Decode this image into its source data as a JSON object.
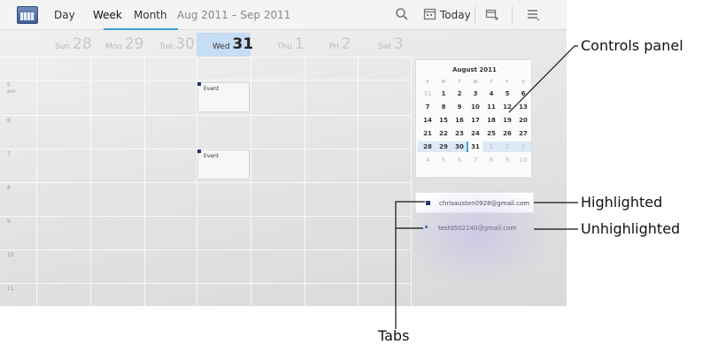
{
  "actionbar": {
    "tabs": [
      {
        "label": "Day"
      },
      {
        "label": "Week"
      },
      {
        "label": "Month"
      }
    ],
    "date_range": "Aug 2011 – Sep 2011",
    "today_label": "Today"
  },
  "days": [
    {
      "dow": "Sun",
      "num": "28"
    },
    {
      "dow": "Mon",
      "num": "29"
    },
    {
      "dow": "Tue",
      "num": "30"
    },
    {
      "dow": "Wed",
      "num": "31"
    },
    {
      "dow": "Thu",
      "num": "1"
    },
    {
      "dow": "Fri",
      "num": "2"
    },
    {
      "dow": "Sat",
      "num": "3"
    }
  ],
  "hours": [
    {
      "h": "5",
      "suffix": "am"
    },
    {
      "h": "6",
      "suffix": ""
    },
    {
      "h": "7",
      "suffix": ""
    },
    {
      "h": "8",
      "suffix": ""
    },
    {
      "h": "9",
      "suffix": ""
    },
    {
      "h": "10",
      "suffix": ""
    },
    {
      "h": "11",
      "suffix": ""
    }
  ],
  "events": [
    {
      "label": "Event"
    },
    {
      "label": "Event"
    }
  ],
  "mini_calendar": {
    "title": "August 2011",
    "weekdays": [
      "S",
      "M",
      "T",
      "W",
      "T",
      "F",
      "S"
    ],
    "rows": [
      [
        "31",
        "1",
        "2",
        "3",
        "4",
        "5",
        "6"
      ],
      [
        "7",
        "8",
        "9",
        "10",
        "11",
        "12",
        "13"
      ],
      [
        "14",
        "15",
        "16",
        "17",
        "18",
        "19",
        "20"
      ],
      [
        "21",
        "22",
        "23",
        "24",
        "25",
        "26",
        "27"
      ],
      [
        "28",
        "29",
        "30",
        "31",
        "1",
        "2",
        "3"
      ],
      [
        "4",
        "5",
        "6",
        "7",
        "8",
        "9",
        "10"
      ]
    ]
  },
  "accounts": [
    {
      "email": "chrisausten0928@gmail.com",
      "color": "#1f2f6f"
    },
    {
      "email": "test0502140@gmail.com",
      "color": "#3e6fc0"
    }
  ],
  "callouts": {
    "controls_panel": "Controls panel",
    "highlighted": "Highlighted",
    "unhighlighted": "Unhighlighted",
    "tabs": "Tabs"
  },
  "colors": {
    "accent": "#3ea2d8",
    "today_header": "#c6ddf3"
  }
}
